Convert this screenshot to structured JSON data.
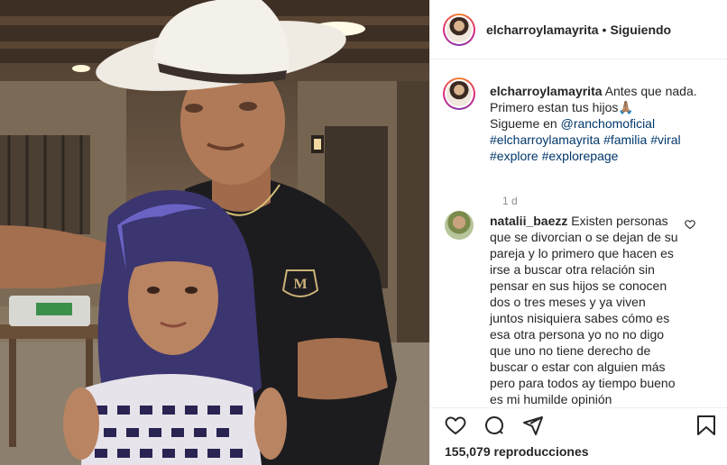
{
  "header": {
    "username": "elcharroylamayrita",
    "separator": "•",
    "follow_status": "Siguiendo"
  },
  "caption": {
    "username": "elcharroylamayrita",
    "line1": "Antes que nada.",
    "line2": "Primero estan tus hijos🙏🏽",
    "line3_prefix": "Sigueme en ",
    "mention": "@ranchomoficial",
    "hashtags_line1": [
      "#elcharroylamayrita",
      "#familia",
      "#viral"
    ],
    "hashtags_line2": [
      "#explore",
      "#explorepage"
    ],
    "time": "1 d"
  },
  "comment": {
    "username": "natalii_baezz",
    "text": "Existen personas que se divorcian o se dejan de su pareja y lo primero que hacen es irse a buscar otra relación sin pensar en sus hijos se conocen dos o tres meses y ya viven juntos nisiquiera sabes cómo es esa otra persona yo no no digo que uno no tiene derecho de buscar o estar con alguien más pero para todos ay tiempo bueno es mi humilde opinión"
  },
  "actions": {
    "icons": [
      "heart-icon",
      "comment-icon",
      "share-icon",
      "bookmark-icon"
    ],
    "views": "155,079 reproducciones"
  },
  "media": {
    "logo_letter": "M"
  }
}
